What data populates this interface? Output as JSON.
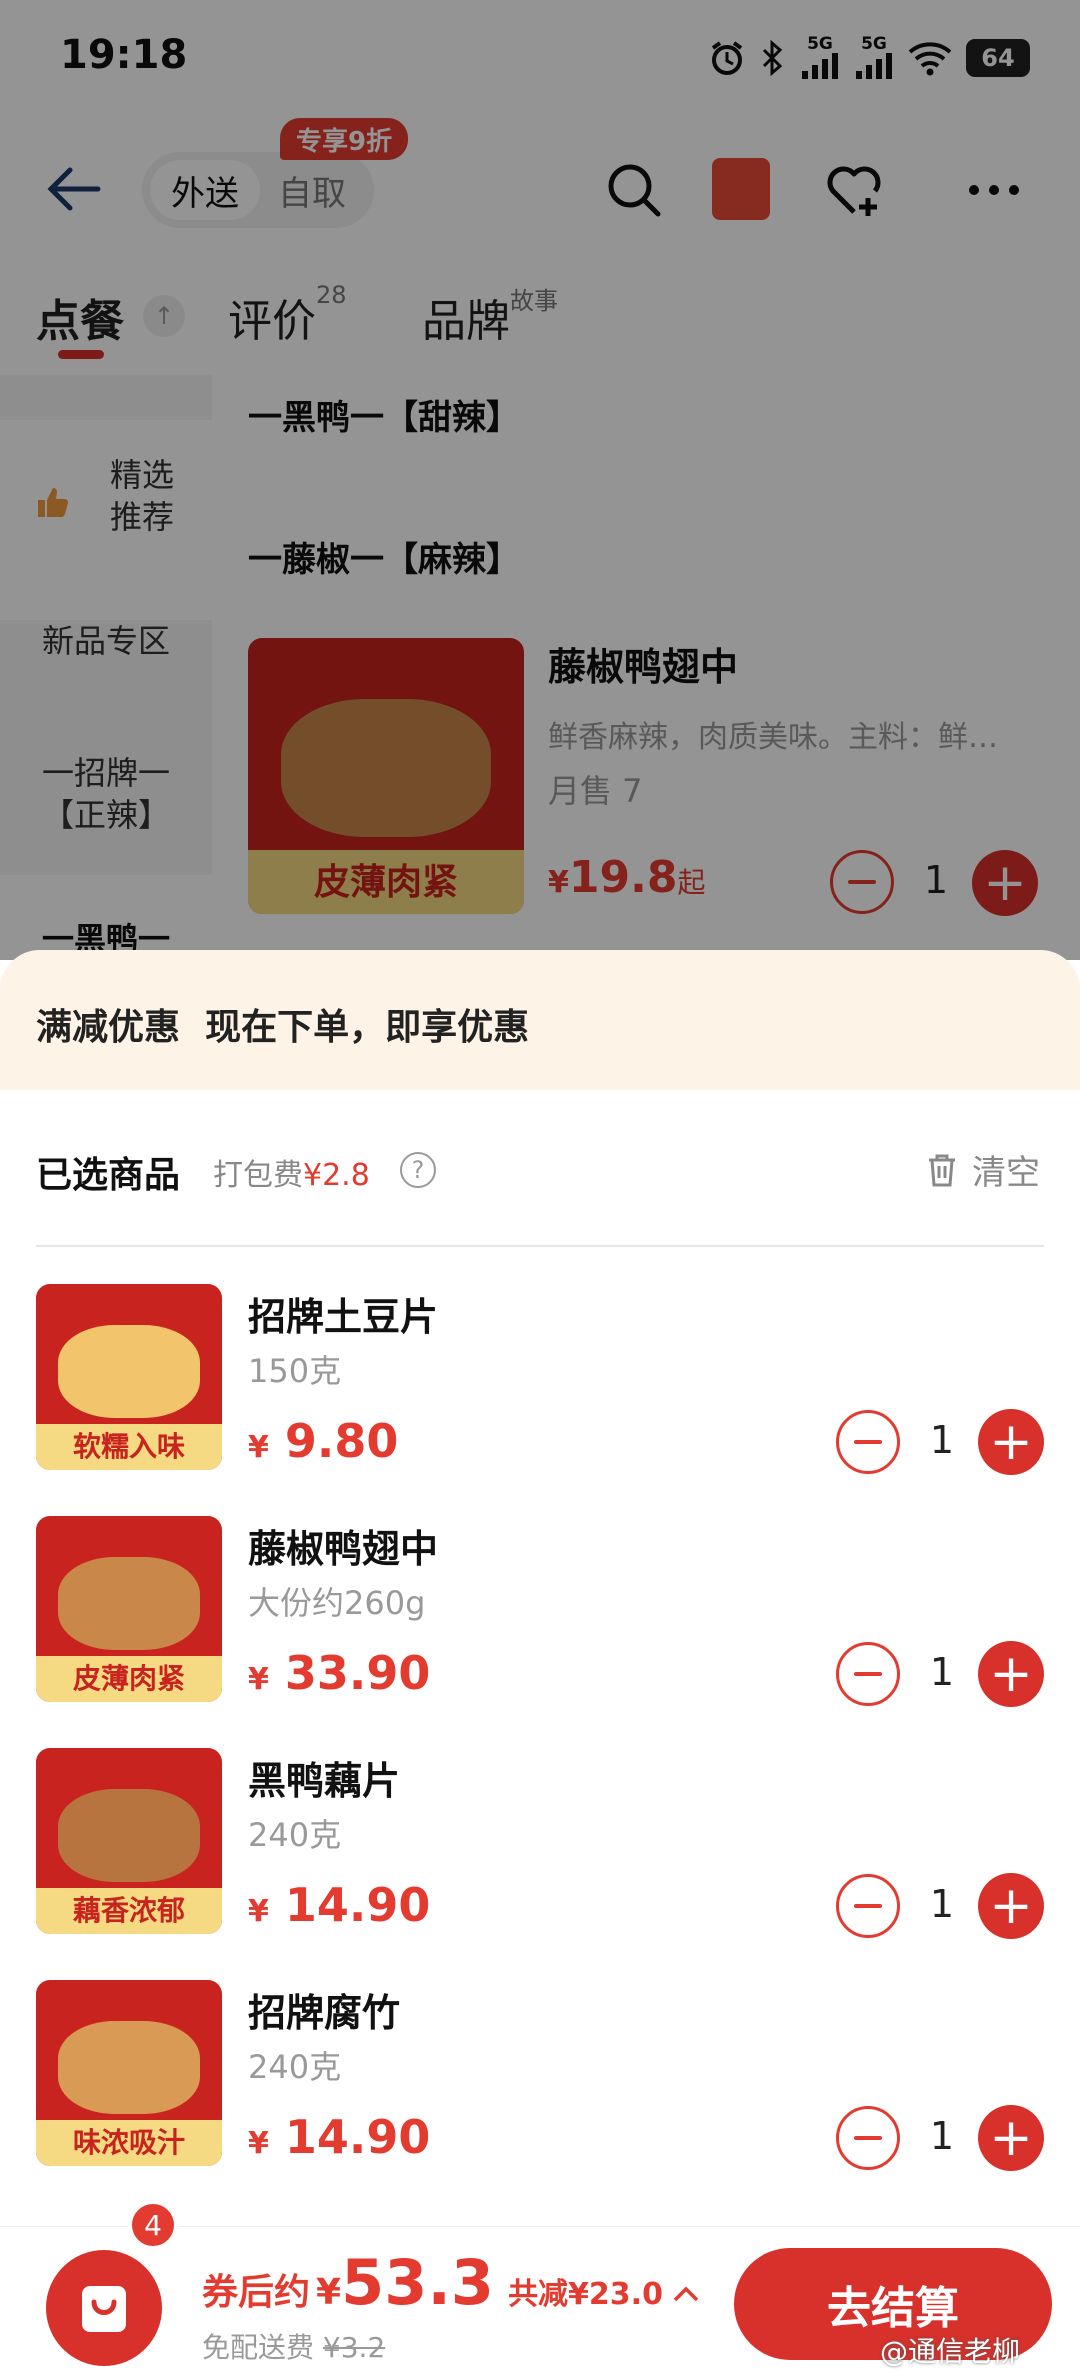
{
  "status_bar": {
    "time": "19:18",
    "battery": "64",
    "net1": "5G",
    "net2": "5G"
  },
  "header": {
    "tab_delivery": "外送",
    "tab_pickup": "自取",
    "promo_tag": "专享9折"
  },
  "tabs": [
    {
      "label": "点餐",
      "sup": ""
    },
    {
      "label": "评价",
      "sup": "28"
    },
    {
      "label": "品牌",
      "sup": "故事"
    }
  ],
  "sidebar": {
    "items": [
      {
        "label": "精选\n推荐"
      },
      {
        "label": "新品专区"
      },
      {
        "label": "一招牌一\n【正辣】"
      },
      {
        "label": "一黑鸭一"
      }
    ]
  },
  "menu": {
    "section_1": "一黑鸭一【甜辣】",
    "section_2": "一藤椒一【麻辣】",
    "item": {
      "name": "藤椒鸭翅中",
      "desc": "鲜香麻辣，肉质美味。主料：鲜…",
      "sales": "月售 7",
      "price_symbol": "¥",
      "price": "19.8",
      "price_suffix": "起",
      "qty": "1",
      "image_band": "皮薄肉紧"
    }
  },
  "cart_sheet": {
    "banner": "满减优惠  现在下单，即享优惠",
    "title": "已选商品",
    "packing_label": "打包费",
    "packing_fee": "¥2.8",
    "help": "?",
    "clear_label": "清空",
    "items": [
      {
        "name": "招牌土豆片",
        "spec": "150克",
        "price": "9.80",
        "qty": "1",
        "band": "软糯入味",
        "color": "#f2c46b"
      },
      {
        "name": "藤椒鸭翅中",
        "spec": "大份约260g",
        "price": "33.90",
        "qty": "1",
        "band": "皮薄肉紧",
        "color": "#c9874a"
      },
      {
        "name": "黑鸭藕片",
        "spec": "240克",
        "price": "14.90",
        "qty": "1",
        "band": "藕香浓郁",
        "color": "#b8743e"
      },
      {
        "name": "招牌腐竹",
        "spec": "240克",
        "price": "14.90",
        "qty": "1",
        "band": "味浓吸汁",
        "color": "#d99a55"
      }
    ],
    "currency": "¥"
  },
  "bottom_bar": {
    "cart_count": "4",
    "after_coupon_label": "券后约",
    "currency": "¥",
    "total": "53.3",
    "discount": "共减¥23.0",
    "delivery_label": "免配送费",
    "delivery_original": "¥3.2",
    "checkout": "去结算"
  },
  "watermark": "@通信老柳",
  "colors": {
    "accent": "#d8302a",
    "price": "#e33b30",
    "banner_bg": "#fdf3e6"
  }
}
